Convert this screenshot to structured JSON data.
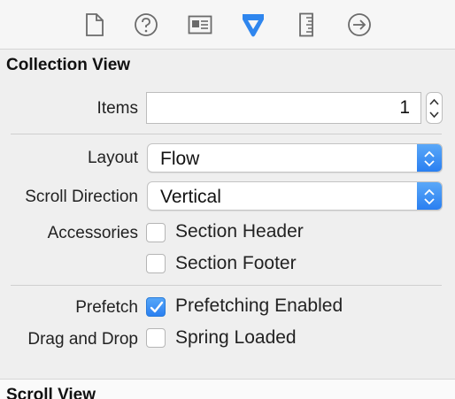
{
  "toolbar": {
    "icons": [
      "file-inspector-icon",
      "quick-help-icon",
      "identity-inspector-icon",
      "attributes-inspector-icon",
      "size-inspector-icon",
      "connections-inspector-icon"
    ],
    "accent_color": "#2f86ee"
  },
  "section": {
    "title": "Collection View"
  },
  "items": {
    "label": "Items",
    "value": "1"
  },
  "layout": {
    "label": "Layout",
    "value": "Flow"
  },
  "scroll_direction": {
    "label": "Scroll Direction",
    "value": "Vertical"
  },
  "accessories": {
    "label": "Accessories",
    "section_header": {
      "label": "Section Header",
      "checked": false
    },
    "section_footer": {
      "label": "Section Footer",
      "checked": false
    }
  },
  "prefetch": {
    "label": "Prefetch",
    "option": "Prefetching Enabled",
    "checked": true
  },
  "drag_and_drop": {
    "label": "Drag and Drop",
    "option": "Spring Loaded",
    "checked": false
  },
  "next_section": {
    "title": "Scroll View"
  }
}
